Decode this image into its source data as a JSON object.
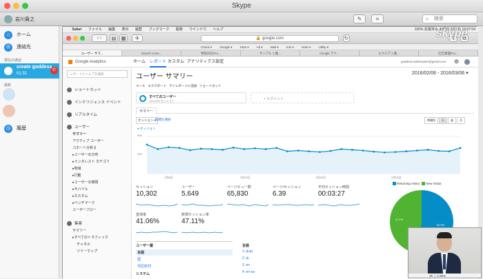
{
  "skype": {
    "title": "Skype",
    "user_name": "岩川貴之",
    "search_placeholder": "検索",
    "nav": [
      {
        "icon": "home-icon",
        "label": "ホーム"
      },
      {
        "icon": "contacts-icon",
        "label": "連絡先"
      }
    ],
    "current_call_header": "現在の通話",
    "call": {
      "name": "create goddess",
      "time": "01:32"
    },
    "recent_header": "最新",
    "history_label": "履歴",
    "watermark": "skype"
  },
  "safari": {
    "menu": [
      "Safari",
      "ファイル",
      "編集",
      "表示",
      "履歴",
      "ブックマーク",
      "開発",
      "ウインドウ",
      "ヘルプ"
    ],
    "status": "100% 充電済み  木曜日 3月7日 15:07:04",
    "url": "google.com",
    "bookmarks": [
      "Check ▾",
      "Google ▾",
      "SNS ▾",
      "Ad ▾",
      "Mail ▾",
      "Info ▾",
      "Note ▾",
      "Utility ▾"
    ],
    "tabs": [
      "ユーザー サマ...",
      "Search Cons...",
      "特別対応Pro...",
      "サンプル 1 集...",
      "Google アナ...",
      "エクスプ 1 集...",
      "広告管理Pro..."
    ],
    "active_tab": 0
  },
  "ga": {
    "brand": "Google Analytics",
    "top_nav": [
      "ホーム",
      "レポート",
      "カスタム",
      "アナリティクス設定"
    ],
    "active_nav": 1,
    "account": "goddess.webmaster@gmail.com",
    "search_placeholder": "レポートとヘルプを検索",
    "side": [
      {
        "icon": "shortcut-icon",
        "label": "ショートカット"
      },
      {
        "icon": "intelligence-icon",
        "label": "インテリジェンス イベント"
      },
      {
        "icon": "realtime-icon",
        "label": "リアルタイム"
      },
      {
        "icon": "users-icon",
        "label": "ユーザー"
      }
    ],
    "side_sub": [
      "サマリー",
      "アクティブ ユーザー",
      "コホート分析 β",
      "▸ユーザーの分布",
      "▸インタレスト カテゴリ",
      "▸地域",
      "▸行動",
      "▸ユーザーの環境",
      "▸モバイル",
      "▸カスタム",
      "▸ベンチマーク",
      "ユーザーフロー"
    ],
    "acq_label": "集客",
    "acq_sub": [
      "サマリー",
      "▸すべてのトラフィック",
      "チャネル",
      "ツリーマップ"
    ],
    "page_title": "ユーザー サマリー",
    "date_range": "2016/02/06 - 2016/03/06",
    "actions": [
      "メール",
      "エクスポート",
      "マイレポートに追加",
      "ショートカット"
    ],
    "segment_all": "すべてのユーザー",
    "segment_sub": "100.00% セッション",
    "segment_add": "+ セグメント",
    "tab_summary": "サマリー",
    "metric_dd": "セッション ▾",
    "compare": "指標を選択",
    "granularity": [
      "時間別",
      "日",
      "週",
      "月"
    ],
    "legend_label": "● セッション",
    "y_labels": [
      "500",
      "250"
    ],
    "x_labels": [
      "2月8日",
      "2月15日",
      "2月22日",
      "2月29日"
    ],
    "metrics": [
      {
        "label": "セッション",
        "value": "10,302"
      },
      {
        "label": "ユーザー",
        "value": "5,649"
      },
      {
        "label": "ページビュー数",
        "value": "65,830"
      },
      {
        "label": "ページ/セッション",
        "value": "6.39"
      },
      {
        "label": "平均セッション時間",
        "value": "00:03:27"
      },
      {
        "label": "直帰率",
        "value": "41.06%"
      },
      {
        "label": "新規セッション率",
        "value": "47.11%"
      }
    ],
    "pie": {
      "legend": [
        {
          "label": "Returning Visitor",
          "color": "#058dc7"
        },
        {
          "label": "New Visitor",
          "color": "#50b432"
        }
      ],
      "values": [
        52.9,
        47.1
      ],
      "labels": [
        "52.9%",
        "47.1%"
      ]
    },
    "table_left_header": "ユーザー層",
    "table_left": [
      "言語",
      "国",
      "市区町村",
      "システム"
    ],
    "table_right_header": "言語",
    "table_right": [
      "1. ja-jp",
      "2. ja",
      "3. en",
      "4. en-us"
    ],
    "table_right_pct": [
      "",
      "",
      "",
      "0.35%"
    ],
    "table_right_n": [
      "",
      "",
      "",
      "36"
    ]
  },
  "chart_data": {
    "type": "line",
    "title": "",
    "xlabel": "",
    "ylabel": "",
    "x": [
      "2/6",
      "2/7",
      "2/8",
      "2/9",
      "2/10",
      "2/11",
      "2/12",
      "2/13",
      "2/14",
      "2/15",
      "2/16",
      "2/17",
      "2/18",
      "2/19",
      "2/20",
      "2/21",
      "2/22",
      "2/23",
      "2/24",
      "2/25",
      "2/26",
      "2/27",
      "2/28",
      "2/29",
      "3/1",
      "3/2",
      "3/3",
      "3/4",
      "3/5",
      "3/6"
    ],
    "series": [
      {
        "values": [
          390,
          330,
          355,
          345,
          315,
          335,
          330,
          320,
          350,
          330,
          340,
          330,
          345,
          300,
          310,
          300,
          290,
          305,
          330,
          320,
          310,
          295,
          285,
          290,
          300,
          310,
          320,
          305,
          300,
          345
        ]
      }
    ],
    "ylim": [
      0,
      500
    ],
    "yticks": [
      250,
      500
    ],
    "grid": true,
    "legend": "top-left"
  }
}
